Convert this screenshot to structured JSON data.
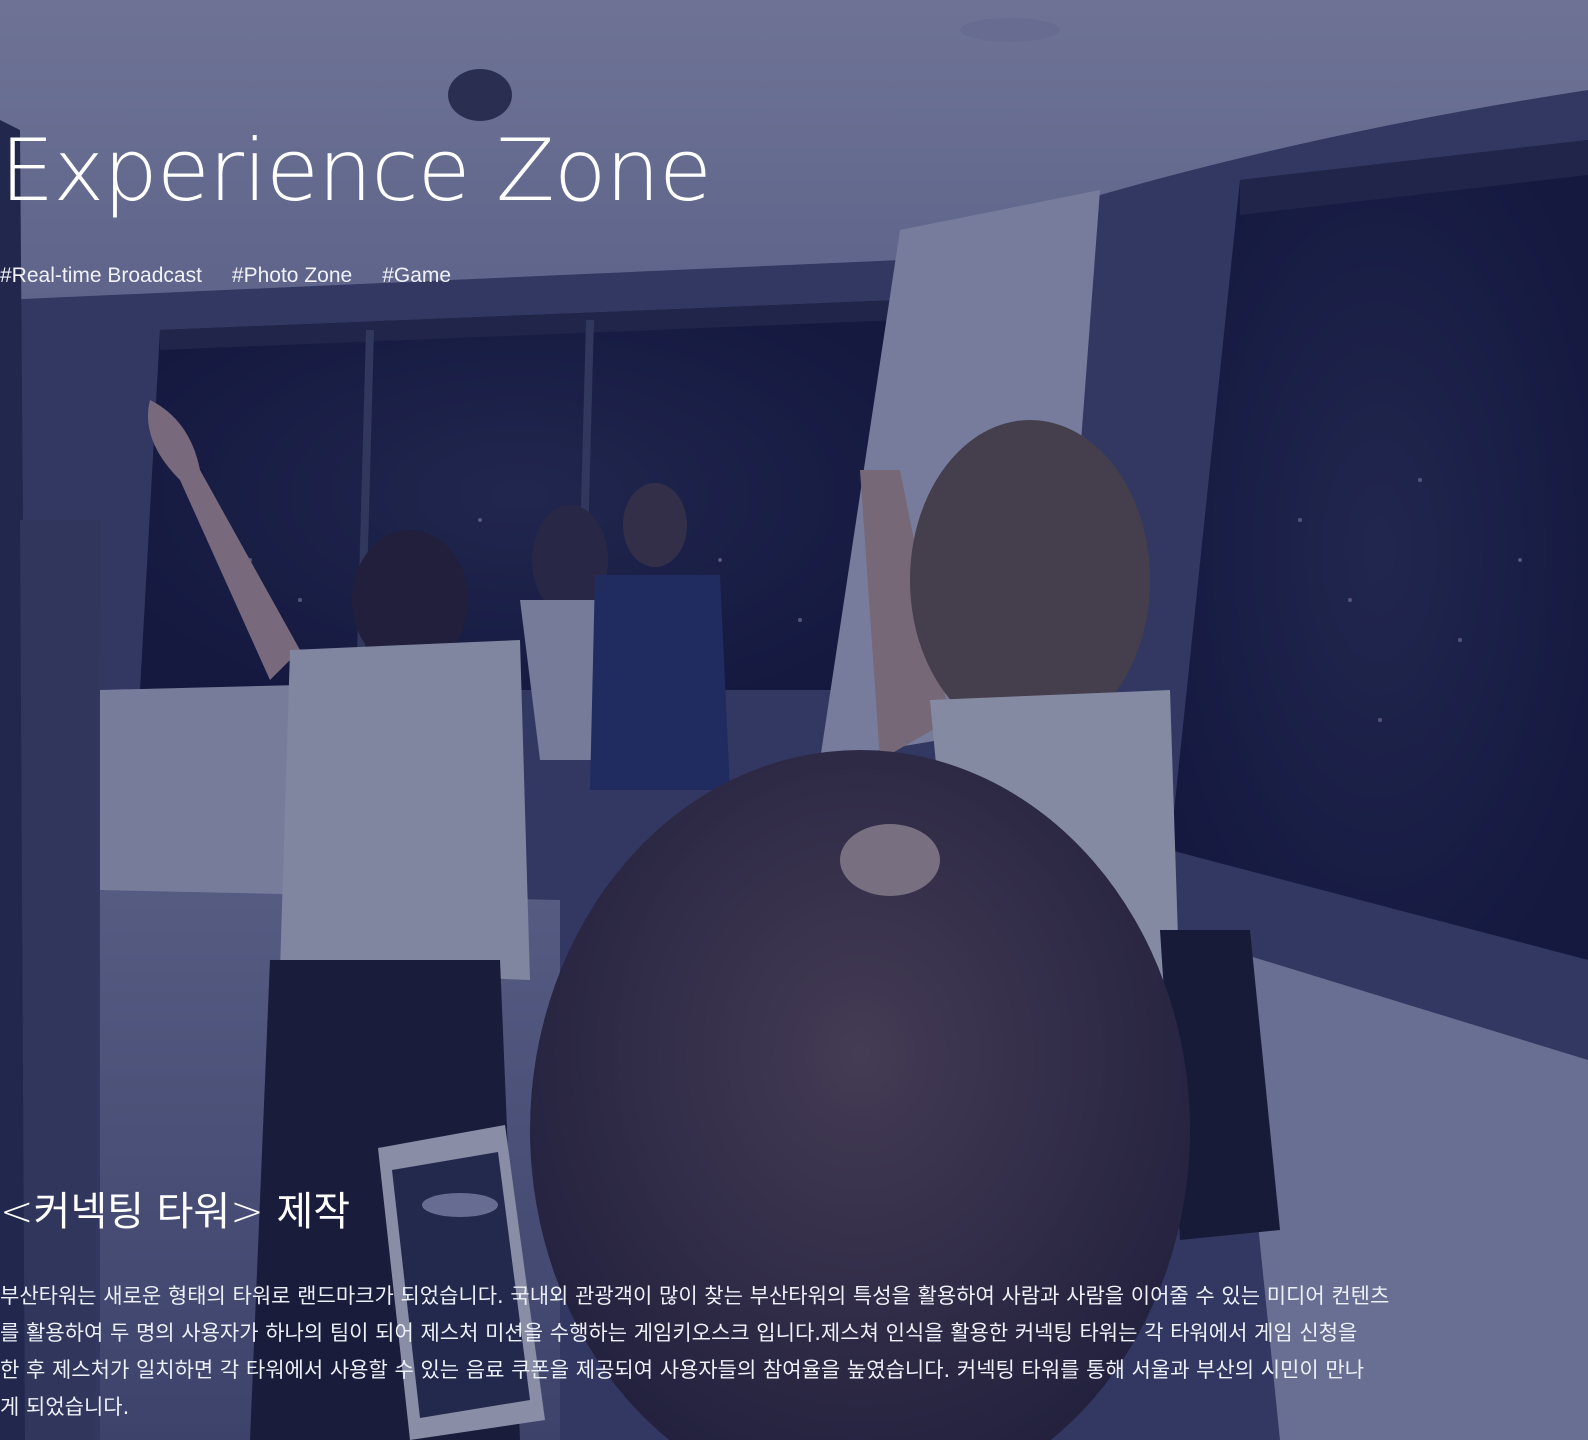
{
  "hero": {
    "title": "Experience Zone",
    "tags": [
      "#Real-time Broadcast",
      "#Photo Zone",
      "#Game"
    ]
  },
  "section": {
    "title": "<커넥팅 타워> 제작",
    "description_lines": [
      "부산타워는 새로운 형태의 타워로 랜드마크가 되었습니다. 국내외 관광객이 많이 찾는 부산타워의 특성을 활용하여 사람과 사람을 이어줄 수 있는 미디어 컨텐츠",
      "를 활용하여 두 명의 사용자가 하나의 팀이 되어 제스처 미션을 수행하는 게임키오스크 입니다.제스쳐 인식을 활용한 커넥팅 타워는 각 타워에서 게임 신청을",
      "한 후 제스처가 일치하면 각 타워에서 사용할 수 있는 음료 쿠폰을 제공되여 사용자들의 참여율을 높였습니다. 커넥팅 타워를 통해 서울과 부산의 시민이 만나",
      "게 되었습니다."
    ]
  },
  "colors": {
    "overlay": "#161c46",
    "text": "#ffffff"
  }
}
